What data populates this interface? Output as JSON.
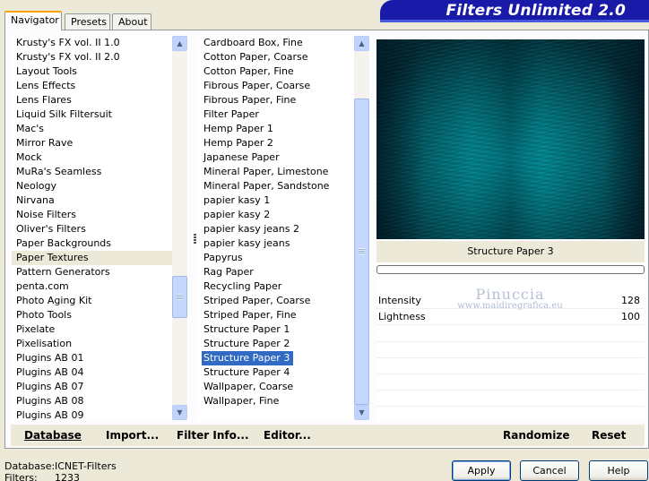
{
  "tabs": [
    {
      "label": "Navigator",
      "active": true
    },
    {
      "label": "Presets",
      "active": false
    },
    {
      "label": "About",
      "active": false
    }
  ],
  "banner": {
    "title": "Filters Unlimited 2.0",
    "color": "#1a1aa8"
  },
  "categories": {
    "items": [
      "Krusty's FX vol. II 1.0",
      "Krusty's FX vol. II 2.0",
      "Layout Tools",
      "Lens Effects",
      "Lens Flares",
      "Liquid Silk Filtersuit",
      "Mac's",
      "Mirror Rave",
      "Mock",
      "MuRa's Seamless",
      "Neology",
      "Nirvana",
      "Noise Filters",
      "Oliver's Filters",
      "Paper Backgrounds",
      "Paper Textures",
      "Pattern Generators",
      "penta.com",
      "Photo Aging Kit",
      "Photo Tools",
      "Pixelate",
      "Pixelisation",
      "Plugins AB 01",
      "Plugins AB 04",
      "Plugins AB 07",
      "Plugins AB 08",
      "Plugins AB 09"
    ],
    "selected": "Paper Textures"
  },
  "filters": {
    "items": [
      "Cardboard Box, Fine",
      "Cotton Paper, Coarse",
      "Cotton Paper, Fine",
      "Fibrous Paper, Coarse",
      "Fibrous Paper, Fine",
      "Filter Paper",
      "Hemp Paper 1",
      "Hemp Paper 2",
      "Japanese Paper",
      "Mineral Paper, Limestone",
      "Mineral Paper, Sandstone",
      "papier kasy 1",
      "papier kasy 2",
      "papier kasy jeans 2",
      "papier kasy jeans",
      "Papyrus",
      "Rag Paper",
      "Recycling Paper",
      "Striped Paper, Coarse",
      "Striped Paper, Fine",
      "Structure Paper 1",
      "Structure Paper 2",
      "Structure Paper 3",
      "Structure Paper 4",
      "Wallpaper, Coarse",
      "Wallpaper, Fine"
    ],
    "selected": "Structure Paper 3",
    "selection_color": "#316ac5"
  },
  "preview": {
    "color": "#0a8a94"
  },
  "filter_panel": {
    "name": "Structure Paper 3",
    "progress": 0,
    "params": [
      {
        "name": "Intensity",
        "value": "128"
      },
      {
        "name": "Lightness",
        "value": "100"
      }
    ]
  },
  "watermark": {
    "title": "Pinuccia",
    "url": "www.maidiregrafica.eu"
  },
  "toolbar": {
    "database_label": "Database",
    "import_label": "Import...",
    "filter_info_label": "Filter Info...",
    "editor_label": "Editor...",
    "randomize_label": "Randomize",
    "reset_label": "Reset"
  },
  "status": {
    "database_label": "Database:",
    "database_value": "ICNET-Filters",
    "filters_label": "Filters:",
    "filters_value": "1233"
  },
  "buttons": {
    "apply": "Apply",
    "cancel": "Cancel",
    "help": "Help"
  }
}
